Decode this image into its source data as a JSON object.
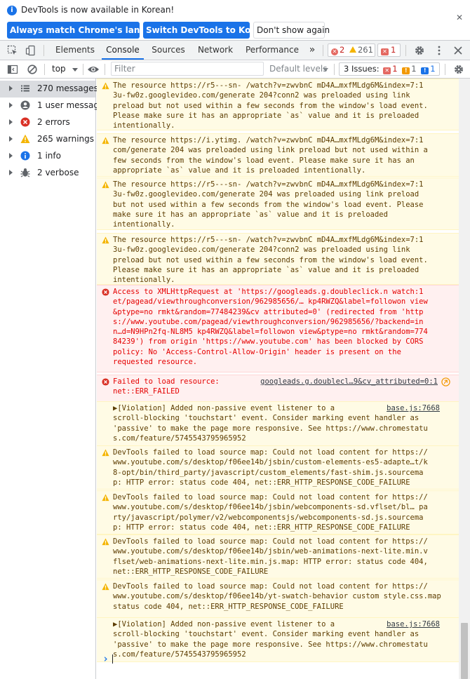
{
  "infobar": {
    "message": "DevTools is now available in Korean!",
    "btn_match": "Always match Chrome's language",
    "btn_switch": "Switch DevTools to Korean",
    "btn_dont_show": "Don't show again"
  },
  "tabs": {
    "elements": "Elements",
    "console": "Console",
    "sources": "Sources",
    "network": "Network",
    "performance": "Performance",
    "more": "»",
    "error_count": "2",
    "warning_count": "261",
    "issue_count": "1"
  },
  "filterbar": {
    "context": "top",
    "filter_placeholder": "Filter",
    "levels": "Default levels",
    "issues_label": "3 Issues:",
    "issue_err": "1",
    "issue_warn": "1",
    "issue_info": "1"
  },
  "sidebar": {
    "items": [
      {
        "label": "270 messages",
        "icon": "list-icon"
      },
      {
        "label": "1 user message",
        "icon": "user-icon"
      },
      {
        "label": "2 errors",
        "icon": "error-icon"
      },
      {
        "label": "265 warnings",
        "icon": "warning-icon"
      },
      {
        "label": "1 info",
        "icon": "info-icon"
      },
      {
        "label": "2 verbose",
        "icon": "bug-icon"
      }
    ]
  },
  "messages": [
    {
      "level": "warn",
      "src": "",
      "lines": [
        "The resource https://r5---sn- /watch?v=zwvbnC mD4A…mxfMLdg6M&index=7:1",
        "3u-fw0z.googlevideo.com/generate 204?conn2 was preloaded using link",
        "preload but not used within a few seconds from the window's load event.",
        "Please make sure it has an appropriate `as` value and it is preloaded",
        "intentionally."
      ]
    },
    {
      "level": "warn",
      "src": "",
      "lines": [
        "The resource https://i.ytimg. /watch?v=zwvbnC mD4A…mxfMLdg6M&index=7:1",
        "com/generate 204 was preloaded using link preload but not used within a",
        "few seconds from the window's load event. Please make sure it has an",
        "appropriate `as` value and it is preloaded intentionally."
      ]
    },
    {
      "level": "warn",
      "src": "",
      "lines": [
        "The resource https://r5---sn- /watch?v=zwvbnC mD4A…mxfMLdg6M&index=7:1",
        "3u-fw0z.googlevideo.com/generate 204 was preloaded using link preload",
        "but not used within a few seconds from the window's load event. Please",
        "make sure it has an appropriate `as` value and it is preloaded",
        "intentionally."
      ]
    },
    {
      "level": "warn",
      "src": "",
      "lines": [
        "The resource https://r5---sn- /watch?v=zwvbnC mD4A…mxfMLdg6M&index=7:1",
        "3u-fw0z.googlevideo.com/generate 204?conn2 was preloaded using link",
        "preload but not used within a few seconds from the window's load event.",
        "Please make sure it has an appropriate `as` value and it is preloaded",
        "intentionally."
      ]
    },
    {
      "level": "err",
      "src": "",
      "lines": [
        "Access to XMLHttpRequest at 'https://googleads.g.doubleclick.n watch:1",
        "et/pagead/viewthroughconversion/962985656/… kp4RWZQ&label=followon view",
        "&ptype=no rmkt&random=77484239&cv attributed=0' (redirected from 'http",
        "s://www.youtube.com/pagead/viewthroughconversion/962985656/?backend=in",
        "n…d=N9HPn2fq-NL8M5 kp4RWZQ&label=followon view&ptype=no rmkt&random=774",
        "84239') from origin 'https://www.youtube.com' has been blocked by CORS",
        "policy: No 'Access-Control-Allow-Origin' header is present on the",
        "requested resource."
      ]
    },
    {
      "level": "err",
      "src": "googleads.g.doublecl…9&cv_attributed=0:1",
      "lines": [
        "Failed to load resource:",
        "net::ERR_FAILED"
      ]
    },
    {
      "level": "log",
      "src": "base.js:7668",
      "lines": [
        "▶[Violation] Added non-passive event listener to a",
        "scroll-blocking 'touchstart' event. Consider marking event handler as",
        "'passive' to make the page more responsive. See https://www.chromestatu",
        "s.com/feature/5745543795965952"
      ]
    },
    {
      "level": "warn",
      "src": "",
      "lines": [
        "DevTools failed to load source map: Could not load content for https://",
        "www.youtube.com/s/desktop/f06ee14b/jsbin/custom-elements-es5-adapte…t/k",
        "8-opt/bin/third_party/javascript/custom_elements/fast-shim.js.sourcema",
        "p: HTTP error: status code 404, net::ERR_HTTP_RESPONSE_CODE_FAILURE"
      ]
    },
    {
      "level": "warn",
      "src": "",
      "lines": [
        "DevTools failed to load source map: Could not load content for https://",
        "www.youtube.com/s/desktop/f06ee14b/jsbin/webcomponents-sd.vflset/bl… pa",
        "rty/javascript/polymer/v2/webcomponentsjs/webcomponents-sd.js.sourcema",
        "p: HTTP error: status code 404, net::ERR_HTTP_RESPONSE_CODE_FAILURE"
      ]
    },
    {
      "level": "warn",
      "src": "",
      "lines": [
        "DevTools failed to load source map: Could not load content for https://",
        "www.youtube.com/s/desktop/f06ee14b/jsbin/web-animations-next-lite.min.v",
        "flset/web-animations-next-lite.min.js.map: HTTP error: status code 404,",
        "net::ERR_HTTP_RESPONSE_CODE_FAILURE"
      ]
    },
    {
      "level": "warn",
      "src": "",
      "lines": [
        "DevTools failed to load source map: Could not load content for https://",
        "www.youtube.com/s/desktop/f06ee14b/yt-swatch-behavior custom style.css.map: HTTP error:",
        "status code 404, net::ERR_HTTP_RESPONSE_CODE_FAILURE"
      ]
    },
    {
      "level": "log",
      "src": "base.js:7668",
      "lines": [
        "▶[Violation] Added non-passive event listener to a",
        "scroll-blocking 'touchstart' event. Consider marking event handler as",
        "'passive' to make the page more responsive. See https://www.chromestatu",
        "s.com/feature/5745543795965952"
      ]
    }
  ],
  "prompt_symbol": "›",
  "colors": {
    "accent": "#1a73e8",
    "warn_bg": "#fffbe5",
    "err_bg": "#fff0f0",
    "err_text": "#e50000",
    "warn_text": "#5c3c00"
  }
}
